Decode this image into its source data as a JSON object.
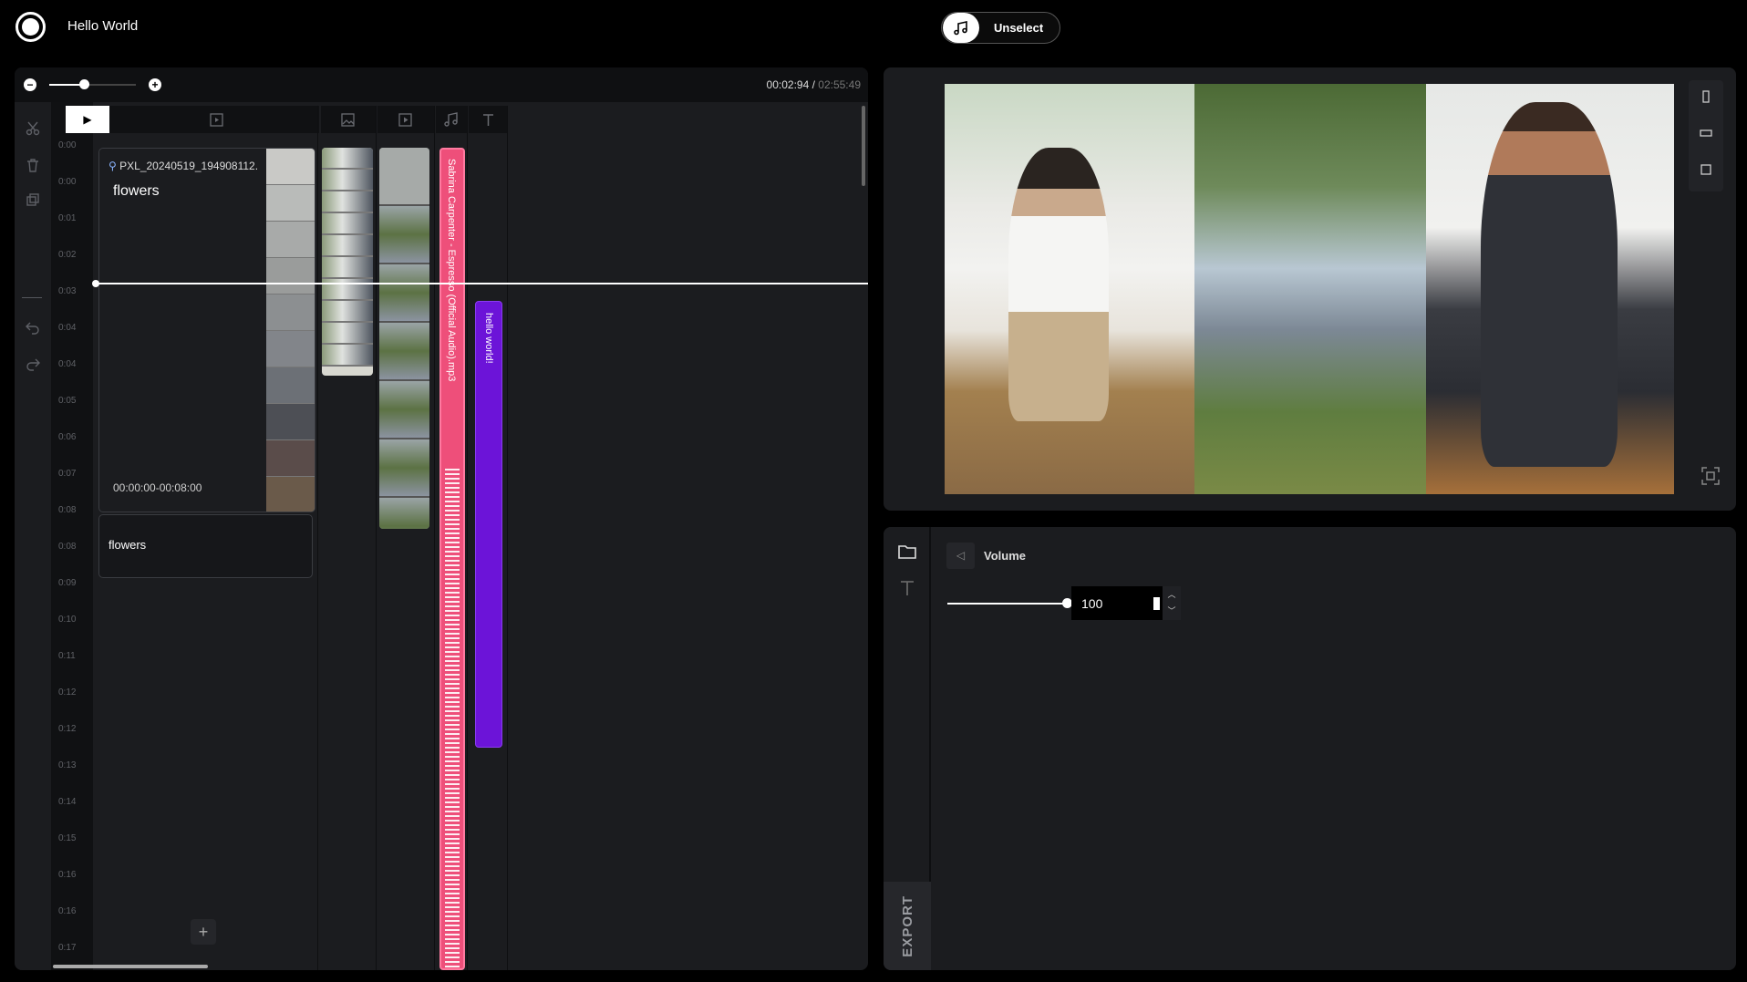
{
  "app": {
    "title": "Hello World"
  },
  "topbar": {
    "unselect_label": "Unselect"
  },
  "timeline": {
    "time_current": "00:02:94",
    "time_sep": " / ",
    "time_total": "02:55:49",
    "zoom_level": 0.38,
    "ruler_ticks": [
      "0:00",
      "0:00",
      "0:01",
      "0:02",
      "0:03",
      "0:04",
      "0:04",
      "0:05",
      "0:06",
      "0:07",
      "0:08",
      "0:08",
      "0:09",
      "0:10",
      "0:11",
      "0:12",
      "0:12",
      "0:13",
      "0:14",
      "0:15",
      "0:16",
      "0:16",
      "0:17"
    ],
    "video_clip": {
      "filename": "PXL_20240519_194908112.",
      "name": "flowers",
      "range": "00:00:00-00:08:00"
    },
    "caption_clip": {
      "text": "flowers"
    },
    "audio_clip": {
      "label": "Sabrina Carpenter - Espresso (Official Audio).mp3"
    },
    "text_clip": {
      "label": "hello world!"
    },
    "add_track_label": "+"
  },
  "properties": {
    "volume_label": "Volume",
    "volume_value": "100",
    "export_label": "EXPORT"
  },
  "colors": {
    "audio": "#ee4f7a",
    "text_clip": "#6c14d8",
    "panel": "#1b1c1f"
  }
}
